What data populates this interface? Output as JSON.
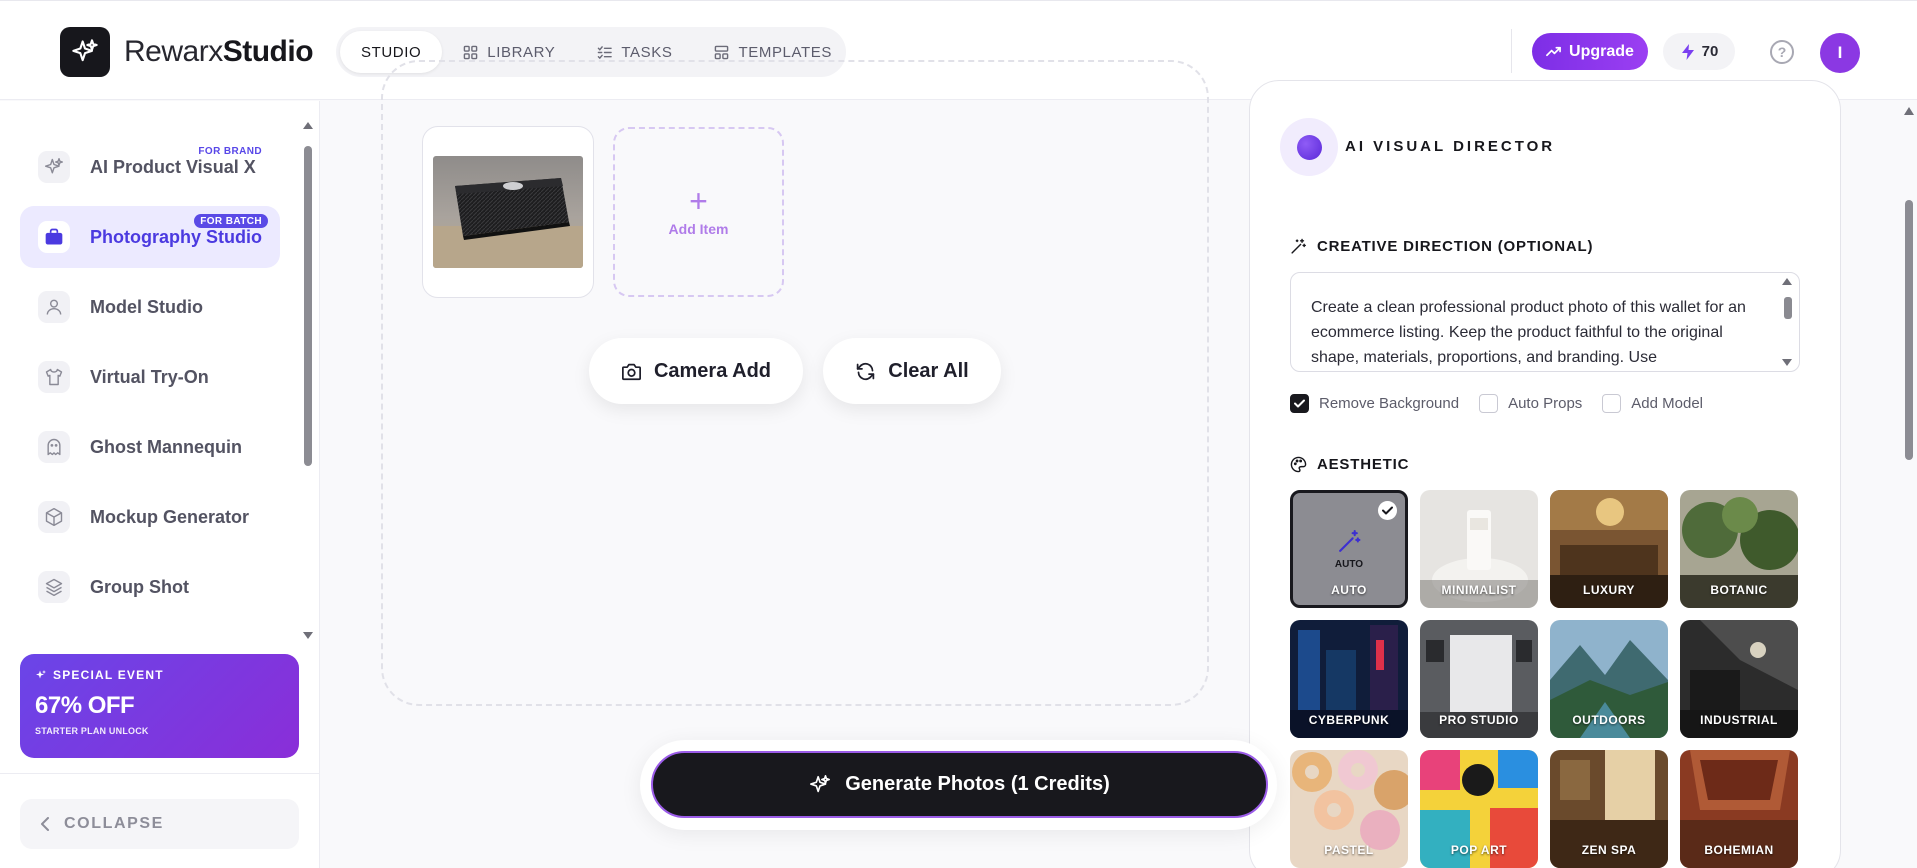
{
  "app": {
    "brand_light": "Rewarx",
    "brand_bold": "Studio"
  },
  "nav": {
    "tabs": [
      {
        "label": "STUDIO",
        "icon": "none"
      },
      {
        "label": "LIBRARY",
        "icon": "grid-icon"
      },
      {
        "label": "TASKS",
        "icon": "checklist-icon"
      },
      {
        "label": "TEMPLATES",
        "icon": "layout-icon"
      }
    ],
    "active": "STUDIO"
  },
  "header": {
    "upgrade_label": "Upgrade",
    "credits": "70",
    "help_glyph": "?",
    "avatar_initial": "I"
  },
  "sidebar": {
    "items": [
      {
        "label": "AI Product Visual X",
        "badge": "FOR BRAND",
        "icon": "sparkle-icon"
      },
      {
        "label": "Photography Studio",
        "badge": "FOR BATCH",
        "icon": "briefcase-icon",
        "active": true
      },
      {
        "label": "Model Studio",
        "badge": "",
        "icon": "person-icon"
      },
      {
        "label": "Virtual Try-On",
        "badge": "",
        "icon": "shirt-icon"
      },
      {
        "label": "Ghost Mannequin",
        "badge": "",
        "icon": "ghost-icon"
      },
      {
        "label": "Mockup Generator",
        "badge": "",
        "icon": "cube-icon"
      },
      {
        "label": "Group Shot",
        "badge": "",
        "icon": "layers-icon"
      }
    ],
    "promo": {
      "tag": "SPECIAL EVENT",
      "headline": "67% OFF",
      "subline": "STARTER PLAN UNLOCK"
    },
    "collapse_label": "COLLAPSE"
  },
  "canvas": {
    "add_item_label": "Add Item",
    "camera_add_label": "Camera Add",
    "clear_all_label": "Clear All",
    "generate_label": "Generate Photos (1 Credits)"
  },
  "director": {
    "title": "AI VISUAL DIRECTOR",
    "creative_title": "CREATIVE DIRECTION (OPTIONAL)",
    "creative_text": "Create a clean professional product photo of this wallet for an ecommerce listing. Keep the product faithful to the original shape, materials, proportions, and branding. Use",
    "options": [
      {
        "label": "Remove Background",
        "checked": true
      },
      {
        "label": "Auto Props",
        "checked": false
      },
      {
        "label": "Add Model",
        "checked": false
      }
    ],
    "aesthetic_title": "AESTHETIC",
    "auto_inner_label": "AUTO",
    "aesthetics": [
      "AUTO",
      "MINIMALIST",
      "LUXURY",
      "BOTANIC",
      "CYBERPUNK",
      "PRO STUDIO",
      "OUTDOORS",
      "INDUSTRIAL",
      "PASTEL",
      "POP ART",
      "ZEN SPA",
      "BOHEMIAN"
    ],
    "selected_aesthetic": "AUTO"
  },
  "colors": {
    "accent": "#5a4ae6",
    "upgrade": "#8a35ec",
    "dark": "#18181d"
  }
}
